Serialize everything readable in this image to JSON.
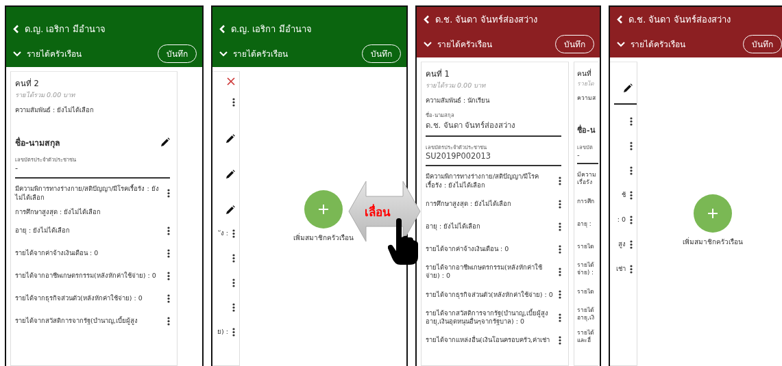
{
  "panels": [
    {
      "kind": "tall",
      "color": "#0b650f",
      "title": "ด.ญ. เอริกา มีอำนาจ",
      "section": "รายได้ครัวเรือน",
      "save": "บันทึก",
      "cards": [
        {
          "kind": "full",
          "items": [
            {
              "kind": "person",
              "text": "คนที่ 2",
              "sub": "รายได้รวม 0.00 บาท"
            },
            {
              "kind": "text",
              "text": "ความสัมพันธ์ : ยังไม่ได้เลือก"
            },
            {
              "kind": "edit",
              "text": "ชื่อ-นามสกุล"
            },
            {
              "kind": "field",
              "caption": "เลขบัตรประจำตัวประชาชน",
              "text": "-"
            },
            {
              "kind": "menu",
              "text": "มีความพิการทางร่างกาย/สติปัญญา/มีโรคเรื้อรัง : ยังไม่ได้เลือก"
            },
            {
              "kind": "text",
              "text": "การศึกษาสูงสุด : ยังไม่ได้เลือก"
            },
            {
              "kind": "menu",
              "text": "อายุ : ยังไม่ได้เลือก"
            },
            {
              "kind": "menu",
              "text": "รายได้จากค่าจ้างเงินเดือน : 0"
            },
            {
              "kind": "menu",
              "text": "รายได้จากอาชีพเกษตรกรรม(หลังหักค่าใช้จ่าย) : 0"
            },
            {
              "kind": "menu",
              "text": "รายได้จากธุรกิจส่วนตัว(หลังหักค่าใช้จ่าย) : 0"
            },
            {
              "kind": "menu",
              "text": "รายได้จากสวัสดิการจากรัฐ(บำนาญ,เบี้ยผู้สูง"
            }
          ]
        }
      ]
    },
    {
      "kind": "tall",
      "color": "#0b650f",
      "title": "ด.ญ. เอริกา มีอำนาจ",
      "section": "รายได้ครัวเรือน",
      "save": "บันทึก",
      "add": "เพิ่มสมาชิกครัวเรือน",
      "cards": [
        {
          "kind": "tail",
          "items": [
            {
              "kind": "close"
            },
            {
              "kind": "menu"
            },
            {
              "kind": "edit"
            },
            {
              "kind": "edit"
            },
            {
              "kind": "edit"
            },
            {
              "kind": "menu",
              "text": "ัง :"
            },
            {
              "kind": "menu"
            },
            {
              "kind": "menu"
            },
            {
              "kind": "menu"
            },
            {
              "kind": "menu",
              "text": "ย) :"
            }
          ]
        }
      ]
    },
    {
      "kind": "compact",
      "color": "#8c1f22",
      "title": "ด.ช. จันดา จันทร์ส่องสว่าง",
      "section": "รายได้ครัวเรือน",
      "save": "บันทึก",
      "cards": [
        {
          "kind": "full",
          "items": [
            {
              "kind": "person",
              "text": "คนที่ 1",
              "sub": "รายได้รวม 0.00 บาท"
            },
            {
              "kind": "text",
              "text": "ความสัมพันธ์ : นักเรียน"
            },
            {
              "kind": "field",
              "caption": "ชื่อ-นามสกุล",
              "text": "ด.ช. จันดา จันทร์ส่องสว่าง"
            },
            {
              "kind": "field",
              "caption": "เลขบัตรประจำตัวประชาชน",
              "text": "SU2019P002013"
            },
            {
              "kind": "menu",
              "text": "มีความพิการทางร่างกาย/สติปัญญา/มีโรคเรื้อรัง : ยังไม่ได้เลือก"
            },
            {
              "kind": "menu",
              "text": "การศึกษาสูงสุด : ยังไม่ได้เลือก"
            },
            {
              "kind": "menu",
              "text": "อายุ : ยังไม่ได้เลือก"
            },
            {
              "kind": "menu",
              "text": "รายได้จากค่าจ้างเงินเดือน : 0"
            },
            {
              "kind": "menu",
              "text": "รายได้จากอาชีพเกษตรกรรม(หลังหักค่าใช้จ่าย) : 0"
            },
            {
              "kind": "menu",
              "text": "รายได้จากธุรกิจส่วนตัว(หลังหักค่าใช้จ่าย) : 0"
            },
            {
              "kind": "menu",
              "text": "รายได้จากสวัสดิการจากรัฐ(บำนาญ,เบี้ยผู้สูงอายุ,เงินอุดหนุนอื่นๆจากรัฐบาล) : 0"
            },
            {
              "kind": "menu",
              "text": "รายได้จากแหล่งอื่น(เงินโอนครอบครัว,ค่าเช่า"
            }
          ]
        },
        {
          "kind": "head",
          "items": [
            {
              "kind": "person",
              "text": "คนที่",
              "sub": "รายได"
            },
            {
              "kind": "text",
              "text": "ความส"
            },
            {
              "kind": "edit",
              "text": "ชื่อ-น"
            },
            {
              "kind": "field",
              "caption": "เลขบัต",
              "text": "-"
            },
            {
              "kind": "menu",
              "text": "มีความ\nเรื่อรัง"
            },
            {
              "kind": "menu",
              "text": "การศึก"
            },
            {
              "kind": "menu",
              "text": "อายุ :"
            },
            {
              "kind": "menu",
              "text": "รายได"
            },
            {
              "kind": "menu",
              "text": "รายได้\nจ่าย) :"
            },
            {
              "kind": "menu",
              "text": "รายได"
            },
            {
              "kind": "menu",
              "text": "รายได้\nอายุ,เงิ"
            },
            {
              "kind": "menu",
              "text": "รายได้\nและอื่"
            }
          ]
        }
      ]
    },
    {
      "kind": "compact",
      "color": "#8c1f22",
      "title": "ด.ช. จันดา จันทร์ส่องสว่าง",
      "section": "รายได้ครัวเรือน",
      "save": "บันทึก",
      "add": "เพิ่มสมาชิกครัวเรือน",
      "cards": [
        {
          "kind": "tail",
          "items": [
            {
              "kind": "edit"
            },
            {
              "kind": "rule"
            },
            {
              "kind": "menu"
            },
            {
              "kind": "menu"
            },
            {
              "kind": "menu"
            },
            {
              "kind": "menu",
              "text": "ช้"
            },
            {
              "kind": "menu",
              "text": ": 0"
            },
            {
              "kind": "menu",
              "text": "สูง"
            },
            {
              "kind": "menu",
              "text": "เช่า"
            }
          ]
        }
      ]
    }
  ],
  "overlay": {
    "label": "เลื่อน"
  }
}
